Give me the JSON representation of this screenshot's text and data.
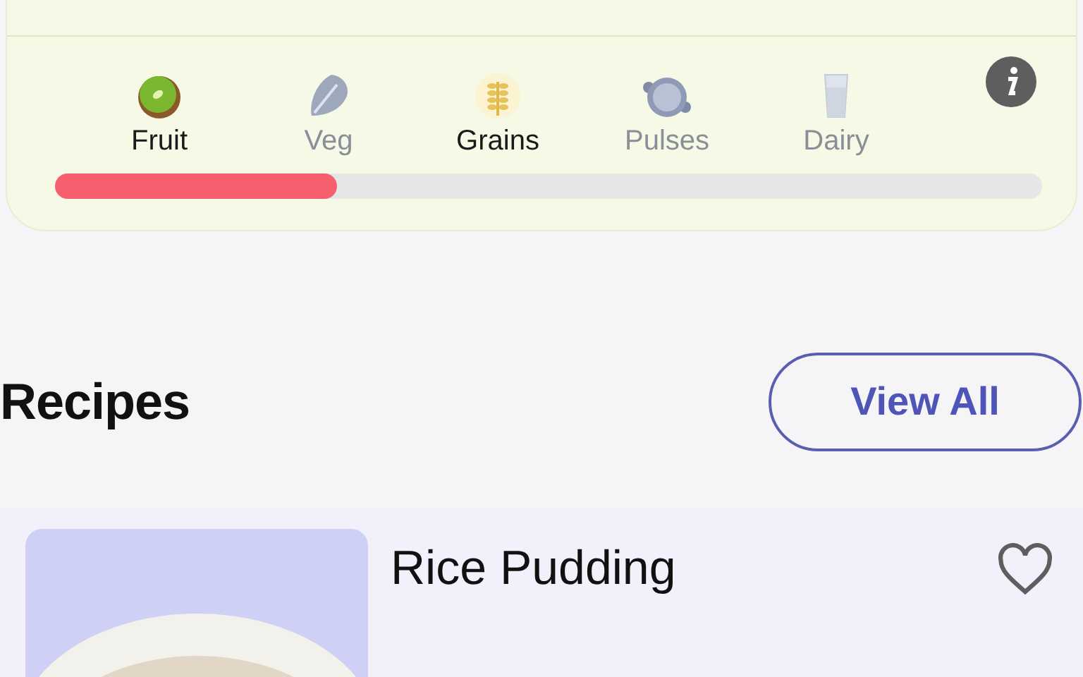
{
  "food_groups": [
    {
      "label": "Fruit",
      "kind": "fruit",
      "achieved": true
    },
    {
      "label": "Veg",
      "kind": "veg",
      "achieved": false
    },
    {
      "label": "Grains",
      "kind": "grains",
      "achieved": true
    },
    {
      "label": "Pulses",
      "kind": "pulses",
      "achieved": false
    },
    {
      "label": "Dairy",
      "kind": "dairy",
      "achieved": false
    }
  ],
  "progress": {
    "level": 0.286
  },
  "recipes_section": {
    "title": "Recipes",
    "view_all": "View All"
  },
  "recipes": [
    {
      "title": "Rice Pudding",
      "favorite": false
    }
  ]
}
